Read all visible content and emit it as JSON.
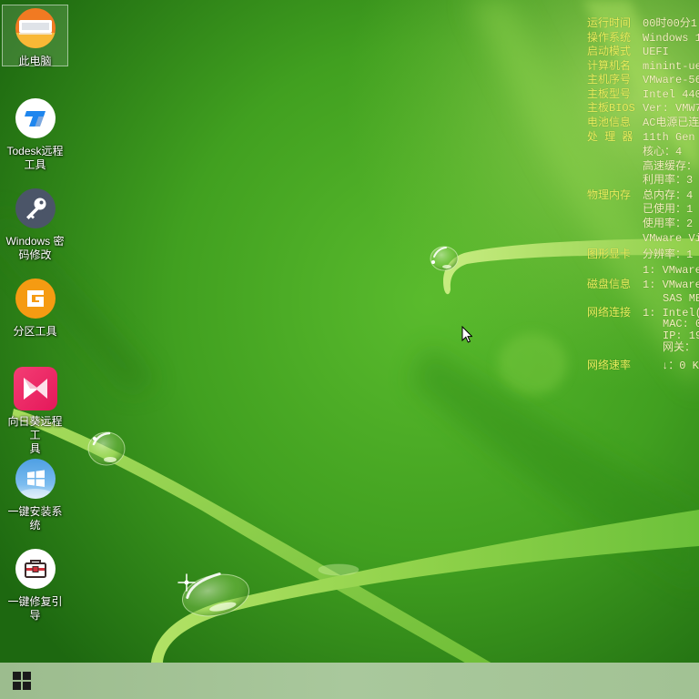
{
  "desktop": {
    "icons": [
      {
        "label": "此电脑",
        "icon": "this-pc-icon",
        "selected": true
      },
      {
        "label": "Todesk远程\n工具",
        "icon": "todesk-icon"
      },
      {
        "label": "Windows 密\n码修改",
        "icon": "key-icon"
      },
      {
        "label": "分区工具",
        "icon": "partition-tool-icon"
      },
      {
        "label": "向日葵远程工\n具",
        "icon": "sunlogin-icon"
      },
      {
        "label": "一键安装系统",
        "icon": "windows-install-icon"
      },
      {
        "label": "一键修复引导",
        "icon": "toolbox-icon"
      }
    ]
  },
  "system_info": {
    "uptime": {
      "label": "运行时间",
      "value": "00时00分1"
    },
    "os": {
      "label": "操作系统",
      "value": "Windows 1"
    },
    "boot_mode": {
      "label": "启动模式",
      "value": "UEFI"
    },
    "computer_name": {
      "label": "计算机名",
      "value": "minint-ue"
    },
    "host_serial": {
      "label": "主机序号",
      "value": "VMware-56"
    },
    "board_model": {
      "label": "主板型号",
      "value": "Intel 440"
    },
    "board_bios": {
      "label": "主板BIOS",
      "value": "Ver: VMW7"
    },
    "battery": {
      "label": "电池信息",
      "value": "AC电源已连"
    },
    "cpu": {
      "label": "处 理 器",
      "model": "11th Gen",
      "cores": "核心：4",
      "cache": "高速缓存：",
      "usage": "利用率：3"
    },
    "memory": {
      "label": "物理内存",
      "total": "总内存：4",
      "used": "已使用：1",
      "usage": "使用率：2",
      "module": "VMware Vi"
    },
    "graphics": {
      "label": "图形显卡",
      "resolution": "分辨率：1",
      "adapter": "1: VMware"
    },
    "disk": {
      "label": "磁盘信息",
      "drive": "1: VMware",
      "bus": "SAS ME"
    },
    "network": {
      "label": "网络连接",
      "adapter": "1: Intel(",
      "mac": "MAC: 0",
      "ip": "IP: 19",
      "gateway": "网关："
    },
    "net_speed": {
      "label": "网络速率",
      "value": "↓：0 K"
    }
  },
  "taskbar": {
    "start_button_icon": "windows-logo-icon"
  },
  "cursor": {
    "icon": "mouse-pointer-icon"
  },
  "colors": {
    "info_label": "#e9ef5d",
    "info_value": "#f3f1bd",
    "taskbar": "#a5c498"
  }
}
